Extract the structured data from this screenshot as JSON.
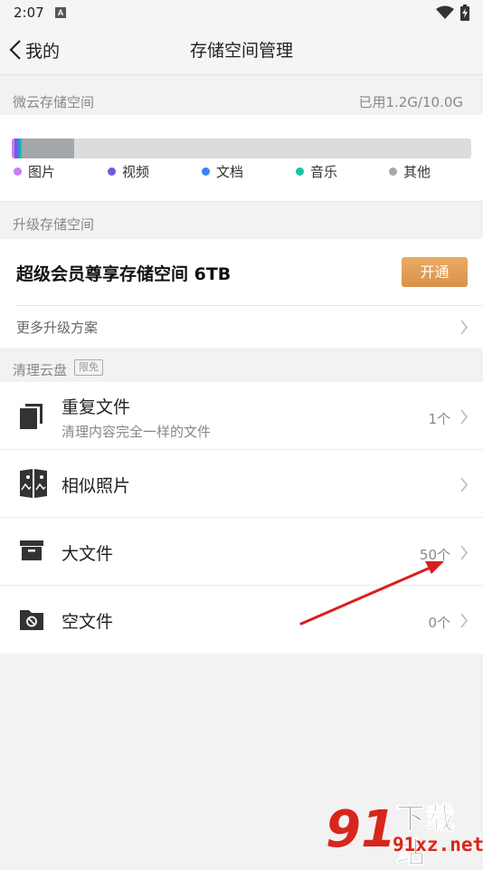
{
  "status": {
    "time": "2:07",
    "notif_letter": "A"
  },
  "nav": {
    "back_label": "我的",
    "title": "存储空间管理"
  },
  "storage": {
    "section_label": "微云存储空间",
    "usage": "已用1.2G/10.0G",
    "legend": [
      {
        "label": "图片",
        "color": "#c77df3"
      },
      {
        "label": "视频",
        "color": "#7b55d9"
      },
      {
        "label": "文档",
        "color": "#3b82f6"
      },
      {
        "label": "音乐",
        "color": "#19c3a3"
      },
      {
        "label": "其他",
        "color": "#a3a8ac"
      }
    ]
  },
  "upgrade": {
    "section_label": "升级存储空间",
    "vip_title": "超级会员尊享存储空间 6TB",
    "open_button": "开通",
    "more_plans": "更多升级方案"
  },
  "clean": {
    "section_label": "清理云盘",
    "badge": "限免",
    "items": [
      {
        "title": "重复文件",
        "subtitle": "清理内容完全一样的文件",
        "count": "1个"
      },
      {
        "title": "相似照片",
        "count": ""
      },
      {
        "title": "大文件",
        "count": "50个"
      },
      {
        "title": "空文件",
        "count": "0个"
      }
    ]
  },
  "watermark": {
    "logo": "91",
    "brand": "下载站",
    "domain": "91xz.net"
  }
}
